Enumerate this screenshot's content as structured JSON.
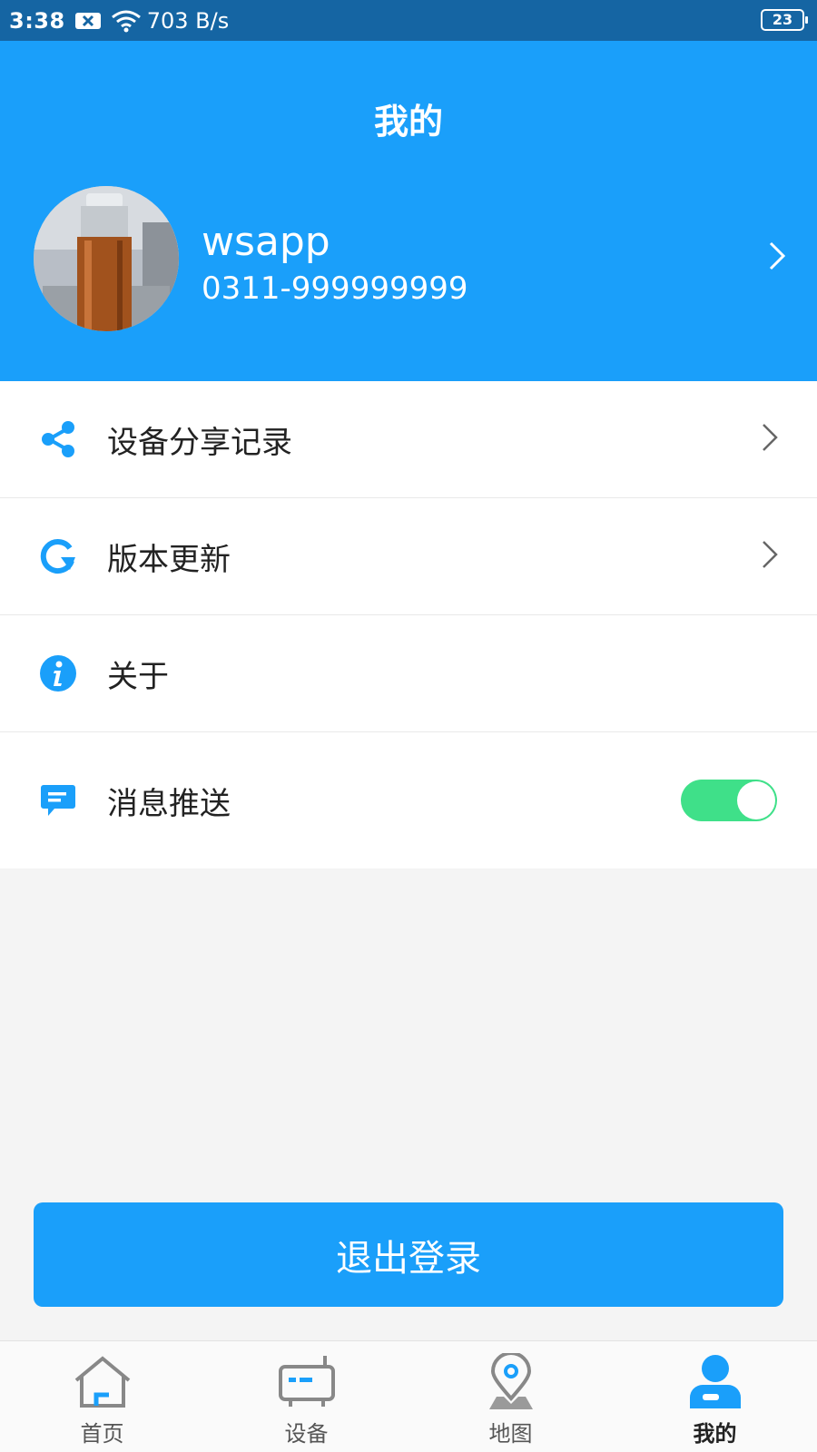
{
  "status_bar": {
    "time": "3:38",
    "network_speed": "703 B/s",
    "battery": "23",
    "icons": [
      "notification-x-icon",
      "wifi-icon",
      "battery-icon"
    ]
  },
  "header": {
    "title": "我的",
    "background_color": "#1a9ffa"
  },
  "profile": {
    "username": "wsapp",
    "phone": "0311-999999999"
  },
  "menu": {
    "items": [
      {
        "label": "设备分享记录",
        "icon": "share-icon"
      },
      {
        "label": "版本更新",
        "icon": "refresh-icon"
      },
      {
        "label": "关于",
        "icon": "info-icon"
      },
      {
        "label": "消息推送",
        "icon": "message-icon",
        "toggle_on": true
      }
    ]
  },
  "logout": {
    "label": "退出登录"
  },
  "tabbar": {
    "tabs": [
      {
        "label": "首页",
        "icon": "home-icon",
        "active": false
      },
      {
        "label": "设备",
        "icon": "device-icon",
        "active": false
      },
      {
        "label": "地图",
        "icon": "map-pin-icon",
        "active": false
      },
      {
        "label": "我的",
        "icon": "user-icon",
        "active": true
      }
    ]
  },
  "colors": {
    "accent": "#1a9ffa",
    "status_bar": "#1565a3",
    "toggle_on": "#3fe089",
    "page_bg": "#f4f4f4"
  }
}
